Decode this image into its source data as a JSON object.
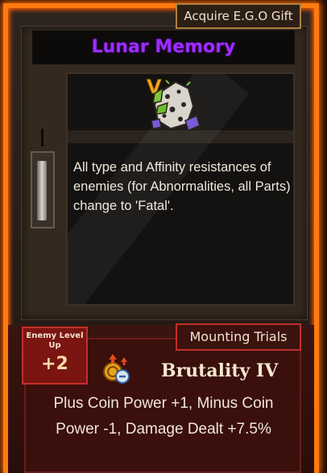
{
  "header": {
    "acquire_label": "Acquire E.G.O Gift"
  },
  "gift": {
    "name": "Lunar Memory",
    "grade": "V",
    "description": "All type and Affinity resistances of enemies (for Abnormalities, all Parts) change to 'Fatal'.",
    "icon": "lunar-memory-gift-icon"
  },
  "trial": {
    "tag_label": "Mounting Trials",
    "enemy_level_label": "Enemy Level Up",
    "enemy_level_value": "+2",
    "keyword_name": "Brutality IV",
    "keyword_icon": "coin-power-icon",
    "keyword_description": "Plus Coin Power +1, Minus Coin Power -1, Damage Dealt +7.5%"
  },
  "colors": {
    "frame_glow": "#ff7a10",
    "title_purple": "#9d2cff",
    "grade_gold": "#f2a41a",
    "trial_red": "#c0302a"
  }
}
